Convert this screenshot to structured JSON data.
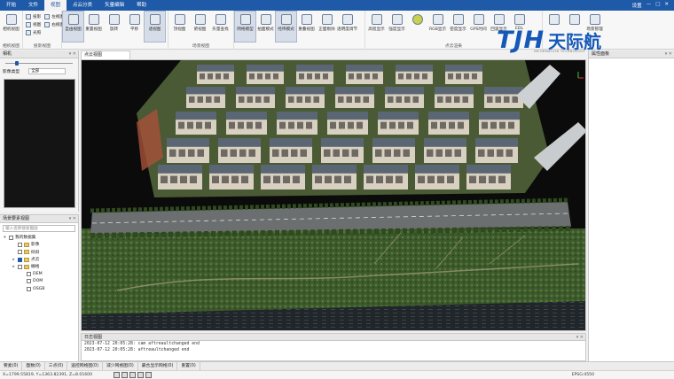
{
  "menu": {
    "items": [
      "开始",
      "文件",
      "视图",
      "点云分类",
      "矢量编辑",
      "帮助"
    ],
    "active_index": 2,
    "right": [
      "设置",
      "—",
      "□",
      "✕"
    ]
  },
  "ribbon": {
    "groups": [
      {
        "label": "相机视图",
        "buttons": [
          "相机视图"
        ]
      },
      {
        "label": "投影视图",
        "small": [
          "投影",
          "视图",
          "光照",
          "左视图",
          "右视图"
        ]
      },
      {
        "label": "",
        "buttons": [
          "自由视图",
          "重置视图",
          "旋转",
          "平移",
          "透视图"
        ]
      },
      {
        "label": "场景视图",
        "buttons": [
          "顶视图",
          "俯视图",
          "矢量查找"
        ]
      },
      {
        "label": "",
        "buttons": [
          "网格模型",
          "拍面模式",
          "经纬模式",
          "重叠视图",
          "正面剔除",
          "透明度调节"
        ]
      },
      {
        "label": "点云渲染",
        "buttons": [
          "高程显示",
          "强度显示",
          "",
          "RGB显示",
          "密度显示",
          "GPS时间",
          "回波显示",
          "EDL"
        ]
      },
      {
        "label": "",
        "buttons": [
          "",
          "",
          "场景管理"
        ]
      }
    ]
  },
  "logo": {
    "mark": "TJH",
    "name": "天际航",
    "tagline": "INFORMATION TECHNOLOGY"
  },
  "camera_panel": {
    "title": "相机",
    "type_label": "影像类型",
    "type_value": "全部"
  },
  "tree_panel": {
    "title": "场景要素视图",
    "search_placeholder": "输入名称搜索图层",
    "nodes": [
      {
        "label": "我的数据集",
        "level": 0,
        "expand": "▾"
      },
      {
        "label": "影像",
        "level": 1
      },
      {
        "label": "倾斜",
        "level": 1
      },
      {
        "label": "点云",
        "level": 1,
        "expand": "▸",
        "checked": true
      },
      {
        "label": "栅格",
        "level": 1,
        "expand": "▸"
      },
      {
        "label": "DEM",
        "level": 2
      },
      {
        "label": "DOM",
        "level": 2
      },
      {
        "label": "OSGB",
        "level": 2
      }
    ]
  },
  "viewport": {
    "tab_label": "点云视图"
  },
  "attr_panel": {
    "title": "属性面板"
  },
  "log_panel": {
    "title": "日志视图",
    "lines": [
      "2023-07-12 20:05:28: cam aftreaultchanged end",
      "2023-07-12 20:05:28: aftreaultchanged end"
    ]
  },
  "bottom_tabs": [
    "要素(0)",
    "面数(0)",
    "三点(0)",
    "遥控网格图(0)",
    "减少网格图(0)",
    "最合显示网格(0)",
    "重置(0)"
  ],
  "status": {
    "coords": "X=1799.55819, Y=1363.82391, Z=8.01600",
    "fps": "EPSG:4550"
  }
}
